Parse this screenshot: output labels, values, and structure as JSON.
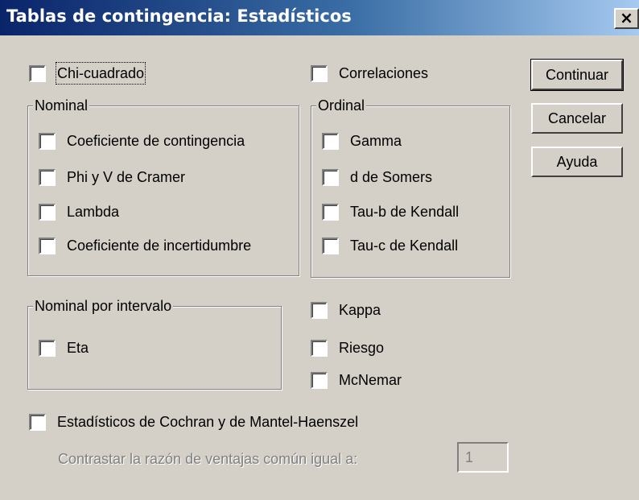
{
  "title": "Tablas de contingencia: Estadísticos",
  "close_glyph": "×",
  "checks": {
    "chi": "Chi-cuadrado",
    "correlaciones": "Correlaciones",
    "coeficiente_contingencia": "Coeficiente de contingencia",
    "phi": "Phi y V de Cramer",
    "lambda": "Lambda",
    "incertidumbre": "Coeficiente de incertidumbre",
    "gamma": "Gamma",
    "somers": "d de Somers",
    "tau_b": "Tau-b de Kendall",
    "tau_c": "Tau-c de Kendall",
    "eta": "Eta",
    "kappa": "Kappa",
    "riesgo": "Riesgo",
    "mcnemar": "McNemar",
    "cochran": "Estadísticos de Cochran y de Mantel-Haenszel"
  },
  "groups": {
    "nominal": "Nominal",
    "ordinal": "Ordinal",
    "nominal_intervalo": "Nominal por intervalo"
  },
  "buttons": {
    "continuar": "Continuar",
    "cancelar": "Cancelar",
    "ayuda": "Ayuda"
  },
  "common_odds": {
    "label": "Contrastar la razón de ventajas común igual a:",
    "value": "1"
  },
  "colors": {
    "face": "#d4d0c8",
    "title_start": "#0a246a",
    "title_end": "#a6caf0"
  }
}
